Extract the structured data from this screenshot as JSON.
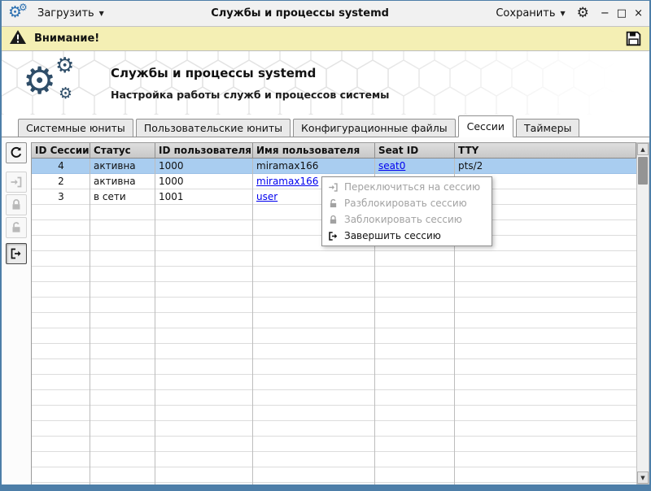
{
  "titlebar": {
    "load_label": "Загрузить",
    "title": "Службы и процессы systemd",
    "save_label": "Сохранить",
    "minimize_glyph": "−",
    "maximize_glyph": "□",
    "close_glyph": "×",
    "dropdown_glyph": "▼"
  },
  "warning_bar": {
    "label": "Внимание!"
  },
  "hero": {
    "title": "Службы и процессы systemd",
    "subtitle": "Настройка работы служб и процессов системы"
  },
  "tabs": [
    {
      "label": "Системные юниты",
      "active": false
    },
    {
      "label": "Пользовательские юниты",
      "active": false
    },
    {
      "label": "Конфигурационные файлы",
      "active": false
    },
    {
      "label": "Сессии",
      "active": true
    },
    {
      "label": "Таймеры",
      "active": false
    }
  ],
  "toolbar": {
    "buttons": [
      {
        "icon": "refresh-icon",
        "enabled": true
      },
      {
        "icon": "switch-session-icon",
        "enabled": false
      },
      {
        "icon": "lock-session-icon",
        "enabled": false
      },
      {
        "icon": "unlock-session-icon",
        "enabled": false
      },
      {
        "icon": "terminate-session-icon",
        "enabled": true
      }
    ]
  },
  "sessions_table": {
    "columns": [
      "ID Сессии",
      "Статус",
      "ID пользователя",
      "Имя пользователя",
      "Seat ID",
      "TTY"
    ],
    "rows": [
      {
        "session_id": "4",
        "status": "активна",
        "user_id": "1000",
        "user_name": "miramax166",
        "seat_id": "seat0",
        "tty": "pts/2",
        "selected": true
      },
      {
        "session_id": "2",
        "status": "активна",
        "user_id": "1000",
        "user_name": "miramax166",
        "seat_id": "",
        "tty": "",
        "selected": false
      },
      {
        "session_id": "3",
        "status": "в сети",
        "user_id": "1001",
        "user_name": "user",
        "seat_id": "",
        "tty": "",
        "selected": false
      }
    ]
  },
  "context_menu": {
    "items": [
      {
        "label": "Переключиться на сессию",
        "icon": "switch-session-icon",
        "enabled": false
      },
      {
        "label": "Разблокировать сессию",
        "icon": "unlock-session-icon",
        "enabled": false
      },
      {
        "label": "Заблокировать сессию",
        "icon": "lock-session-icon",
        "enabled": false
      },
      {
        "label": "Завершить сессию",
        "icon": "terminate-session-icon",
        "enabled": true
      }
    ]
  },
  "scrollbar": {
    "up_glyph": "▲",
    "down_glyph": "▼"
  },
  "icons": {
    "gear_glyph": "⚙"
  },
  "colors": {
    "warning_bg": "#f4efb4",
    "selected_row_bg": "#a9cdf0",
    "link_color": "#0000ee",
    "window_border": "#4d7ea8",
    "logo_color": "#2e4d68",
    "app_icon_color": "#2a6fb0"
  }
}
